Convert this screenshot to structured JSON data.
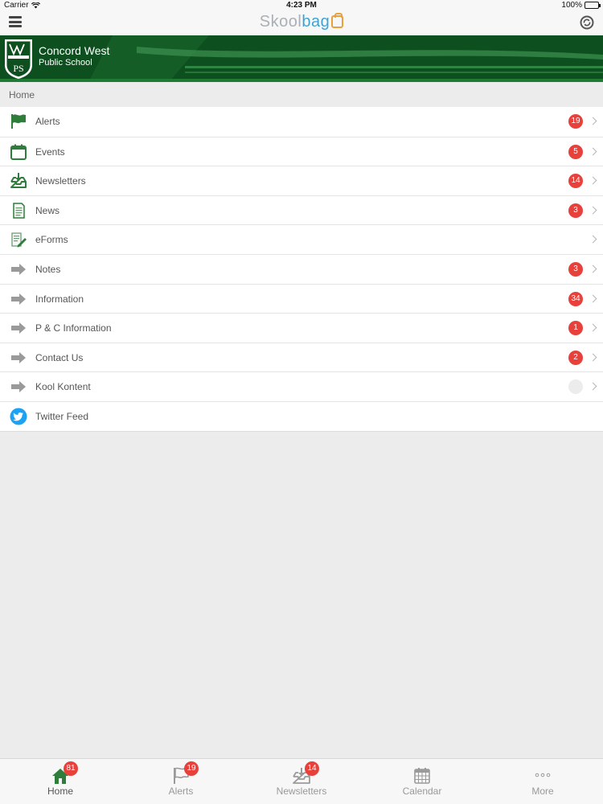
{
  "status_bar": {
    "carrier": "Carrier",
    "time": "4:23 PM",
    "battery": "100%",
    "battery_level": 1.0
  },
  "header": {
    "brand_part1": "Skool",
    "brand_part2": "bag",
    "icons": [
      "hamburger-menu-icon",
      "sync-icon"
    ]
  },
  "banner": {
    "school_line1": "Concord West",
    "school_line2": "Public School",
    "crest_letters": "PS",
    "colors": {
      "background": "#0e4f1f",
      "stripe": "#1f7a33"
    }
  },
  "breadcrumb": "Home",
  "menu": {
    "items": [
      {
        "label": "Alerts",
        "badge": "19",
        "icon": "flag-icon"
      },
      {
        "label": "Events",
        "badge": "5",
        "icon": "calendar-icon"
      },
      {
        "label": "Newsletters",
        "badge": "14",
        "icon": "inbox-download-icon"
      },
      {
        "label": "News",
        "badge": "3",
        "icon": "document-icon"
      },
      {
        "label": "eForms",
        "badge": "",
        "icon": "form-pencil-icon"
      },
      {
        "label": "Notes",
        "badge": "3",
        "icon": "arrow-right-icon"
      },
      {
        "label": "Information",
        "badge": "34",
        "icon": "arrow-right-icon"
      },
      {
        "label": "P & C Information",
        "badge": "1",
        "icon": "arrow-right-icon"
      },
      {
        "label": "Contact Us",
        "badge": "2",
        "icon": "arrow-right-icon"
      },
      {
        "label": "Kool Kontent",
        "badge": "",
        "icon": "arrow-right-icon"
      },
      {
        "label": "Twitter Feed",
        "badge": "",
        "icon": "twitter-icon"
      }
    ]
  },
  "tabs": [
    {
      "label": "Home",
      "badge": "81",
      "icon": "home-icon"
    },
    {
      "label": "Alerts",
      "badge": "19",
      "icon": "flag-icon"
    },
    {
      "label": "Newsletters",
      "badge": "14",
      "icon": "inbox-download-icon"
    },
    {
      "label": "Calendar",
      "badge": "",
      "icon": "calendar-grid-icon"
    },
    {
      "label": "More",
      "badge": "",
      "icon": "more-dots-icon"
    }
  ],
  "colors": {
    "badge": "#e8403b",
    "brand_grey": "#aab0b5",
    "brand_blue": "#3aa4d6",
    "brand_orange": "#e9a23b",
    "icon_green": "#2e7d3b",
    "twitter_blue": "#1da1f2"
  }
}
